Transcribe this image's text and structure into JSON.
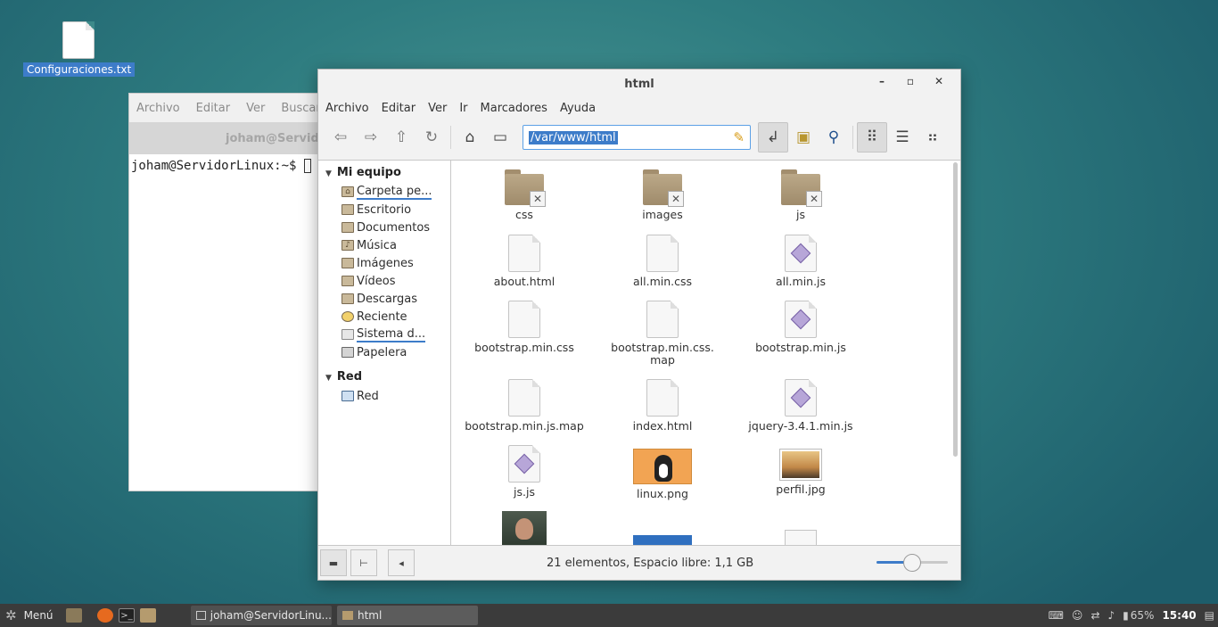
{
  "desktop": {
    "icon_label": "Configuraciones.txt"
  },
  "terminal": {
    "menu": [
      "Archivo",
      "Editar",
      "Ver",
      "Buscar"
    ],
    "title": "joham@ServidorLinux: ~",
    "prompt": "joham@ServidorLinux:~$"
  },
  "fm": {
    "title": "html",
    "menu": [
      "Archivo",
      "Editar",
      "Ver",
      "Ir",
      "Marcadores",
      "Ayuda"
    ],
    "location": "/var/www/html",
    "sidebar": {
      "group1": "Mi equipo",
      "items": [
        {
          "label": "Carpeta pe...",
          "icon": "home-folder-icon"
        },
        {
          "label": "Escritorio",
          "icon": "desktop-folder-icon"
        },
        {
          "label": "Documentos",
          "icon": "documents-folder-icon"
        },
        {
          "label": "Música",
          "icon": "music-folder-icon"
        },
        {
          "label": "Imágenes",
          "icon": "pictures-folder-icon"
        },
        {
          "label": "Vídeos",
          "icon": "videos-folder-icon"
        },
        {
          "label": "Descargas",
          "icon": "downloads-folder-icon"
        },
        {
          "label": "Reciente",
          "icon": "recent-clock-icon"
        },
        {
          "label": "Sistema d...",
          "icon": "filesystem-drive-icon"
        },
        {
          "label": "Papelera",
          "icon": "trash-icon"
        }
      ],
      "group2": "Red",
      "net_items": [
        {
          "label": "Red",
          "icon": "network-icon"
        }
      ]
    },
    "files": [
      {
        "name": "css",
        "type": "folder-locked"
      },
      {
        "name": "images",
        "type": "folder-locked"
      },
      {
        "name": "js",
        "type": "folder-locked"
      },
      {
        "name": "about.html",
        "type": "text"
      },
      {
        "name": "all.min.css",
        "type": "text"
      },
      {
        "name": "all.min.js",
        "type": "js"
      },
      {
        "name": "bootstrap.min.css",
        "type": "text"
      },
      {
        "name": "bootstrap.min.css.\nmap",
        "type": "text"
      },
      {
        "name": "bootstrap.min.js",
        "type": "js"
      },
      {
        "name": "bootstrap.min.js.map",
        "type": "text"
      },
      {
        "name": "index.html",
        "type": "text"
      },
      {
        "name": "jquery-3.4.1.min.js",
        "type": "js"
      },
      {
        "name": "js.js",
        "type": "js"
      },
      {
        "name": "linux.png",
        "type": "image-linux"
      },
      {
        "name": "perfil.jpg",
        "type": "image-perfil"
      }
    ],
    "status": "21 elementos, Espacio libre: 1,1 GB",
    "zoom_level": 0.5
  },
  "taskbar": {
    "menu_label": "Menú",
    "tasks": [
      "joham@ServidorLinu...",
      "html"
    ],
    "battery": "65%",
    "clock": "15:40"
  }
}
